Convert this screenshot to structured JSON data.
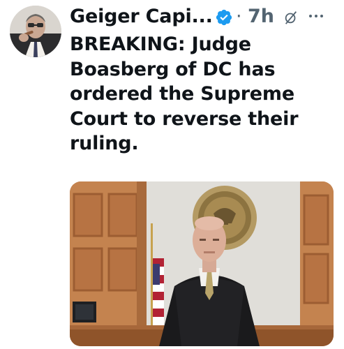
{
  "tweet": {
    "author_name": "Geiger Capi...",
    "separator": "·",
    "timestamp": "7h",
    "text_lines": [
      "BREAKING: Judge",
      "Boasberg of DC has",
      "ordered the Supreme",
      "Court to reverse their",
      "ruling."
    ]
  },
  "icons": {
    "verified": "verified-badge-icon",
    "grok": "grok-icon",
    "more": "more-options-icon"
  },
  "colors": {
    "verified_blue": "#1d9bf0",
    "secondary_text": "#536471",
    "primary_text": "#0f1419"
  }
}
